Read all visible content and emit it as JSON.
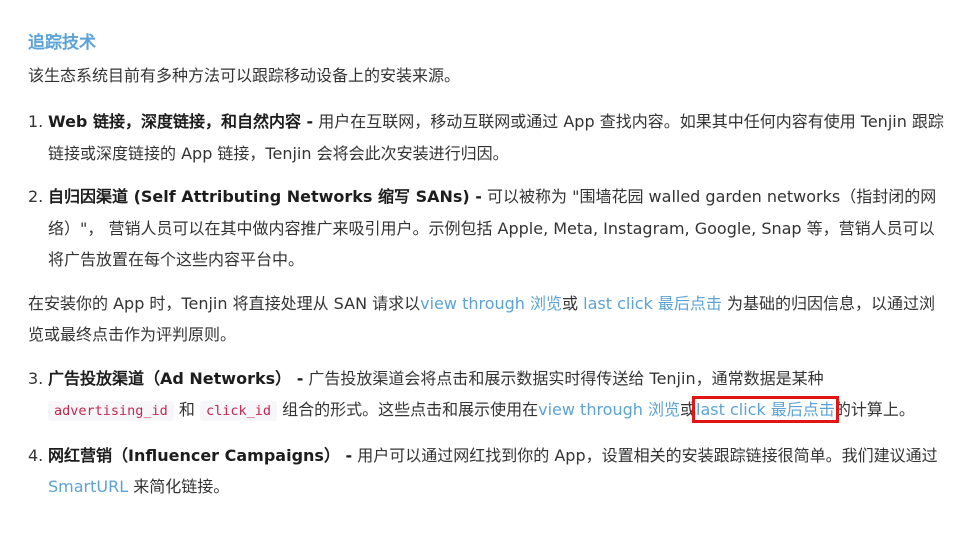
{
  "heading": "追踪技术",
  "intro": "该生态系统目前有多种方法可以跟踪移动设备上的安装来源。",
  "items": [
    {
      "num": "1.",
      "title": "Web 链接，深度链接，和自然内容 -",
      "text": " 用户在互联网，移动互联网或通过 App 查找内容。如果其中任何内容有使用 Tenjin 跟踪链接或深度链接的 App 链接，Tenjin 会将会此次安装进行归因。"
    },
    {
      "num": "2.",
      "title": "自归因渠道 (Self Attributing Networks 缩写 SANs) -",
      "text": " 可以被称为 \"围墙花园 walled garden networks（指封闭的网络）\"， 营销人员可以在其中做内容推广来吸引用户。示例包括 Apple, Meta, Instagram, Google, Snap 等，营销人员可以将广告放置在每个这些内容平台中。"
    },
    {
      "num": "3.",
      "title": "广告投放渠道（Ad Networks） -",
      "text1": " 广告投放渠道会将点击和展示数据实时得传送给 Tenjin，通常数据是某种 ",
      "code1": "advertising_id",
      "text2": " 和 ",
      "code2": "click_id",
      "text3": " 组合的形式。这些点击和展示使用在",
      "link1": "view through 浏览",
      "text4": "或",
      "link2": "last click 最后点击",
      "text5": "的计算上。"
    },
    {
      "num": "4.",
      "title": "网红营销（Influencer Campaigns） -",
      "text1": " 用户可以通过网红找到你的 App，设置相关的安装跟踪链接很简单。我们建议通过 ",
      "link": "SmartURL",
      "text2": " 来简化链接。"
    }
  ],
  "san_paragraph": {
    "text1": "在安装你的 App 时，Tenjin 将直接处理从 SAN 请求以",
    "link1": "view through 浏览",
    "text2": "或 ",
    "link2": "last click 最后点击",
    "text3": " 为基础的归因信息，以通过浏览或最终点击作为评判原则。"
  },
  "colors": {
    "link": "#5ba3d6",
    "highlight_box": "#e31414",
    "code_text": "#c7254e"
  }
}
